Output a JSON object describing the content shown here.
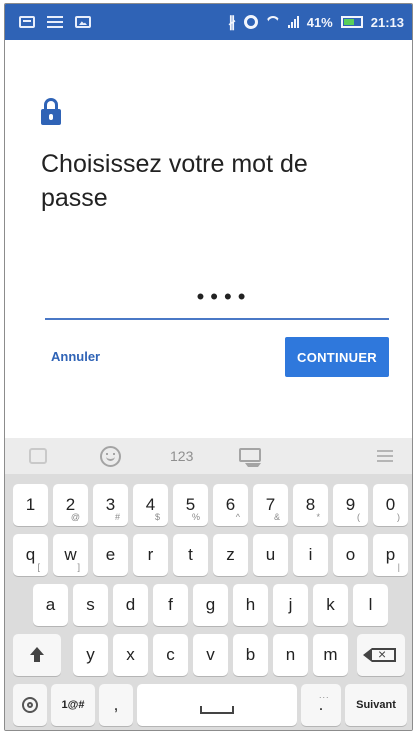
{
  "status_bar": {
    "icons_left": [
      "message-icon",
      "usb-icon",
      "image-icon"
    ],
    "icons_right": [
      "bluetooth-icon",
      "sync-icon",
      "wifi-icon",
      "signal-icon",
      "battery-icon"
    ],
    "bluetooth_glyph": "∦",
    "battery": "41%",
    "time": "21:13"
  },
  "dialog": {
    "icon": "lock-icon",
    "title": "Choisissez votre mot de passe",
    "password_mask": "••••",
    "cancel_label": "Annuler",
    "continue_label": "CONTINUER"
  },
  "keyboard": {
    "toolbar": {
      "numbers_label": "123"
    },
    "row1": [
      {
        "k": "1",
        "s": ""
      },
      {
        "k": "2",
        "s": "@"
      },
      {
        "k": "3",
        "s": "#"
      },
      {
        "k": "4",
        "s": "$"
      },
      {
        "k": "5",
        "s": "%"
      },
      {
        "k": "6",
        "s": "^"
      },
      {
        "k": "7",
        "s": "&"
      },
      {
        "k": "8",
        "s": "*"
      },
      {
        "k": "9",
        "s": "("
      },
      {
        "k": "0",
        "s": ")"
      }
    ],
    "row2": [
      {
        "k": "q",
        "s": "["
      },
      {
        "k": "w",
        "s": "]"
      },
      {
        "k": "e",
        "s": ""
      },
      {
        "k": "r",
        "s": ""
      },
      {
        "k": "t",
        "s": ""
      },
      {
        "k": "z",
        "s": ""
      },
      {
        "k": "u",
        "s": ""
      },
      {
        "k": "i",
        "s": ""
      },
      {
        "k": "o",
        "s": ""
      },
      {
        "k": "p",
        "s": "|"
      }
    ],
    "row3": [
      {
        "k": "a",
        "s": ""
      },
      {
        "k": "s",
        "s": ""
      },
      {
        "k": "d",
        "s": ""
      },
      {
        "k": "f",
        "s": ""
      },
      {
        "k": "g",
        "s": ""
      },
      {
        "k": "h",
        "s": ""
      },
      {
        "k": "j",
        "s": ""
      },
      {
        "k": "k",
        "s": ""
      },
      {
        "k": "l",
        "s": ""
      }
    ],
    "row4": [
      {
        "k": "y",
        "s": ""
      },
      {
        "k": "x",
        "s": ""
      },
      {
        "k": "c",
        "s": ""
      },
      {
        "k": "v",
        "s": ""
      },
      {
        "k": "b",
        "s": ""
      },
      {
        "k": "n",
        "s": ""
      },
      {
        "k": "m",
        "s": ""
      }
    ],
    "symbols_label": "1@#",
    "comma_label": ",",
    "period_label": ".",
    "period_sub": "...",
    "enter_label": "Suivant"
  },
  "colors": {
    "status_bar": "#2f63b6",
    "accent": "#2f63b6",
    "button": "#2f78dc",
    "keyboard_bg": "#dcdcdc"
  }
}
